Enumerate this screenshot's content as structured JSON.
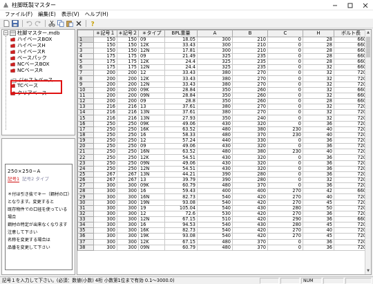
{
  "window": {
    "title": "柱脚既製マスター"
  },
  "menu": [
    "ファイル(F)",
    "編集(E)",
    "表示(V)",
    "ヘルプ(H)"
  ],
  "tree": {
    "root_label": "柱脚マスター.mdb",
    "items": [
      "ハイベースBOX",
      "ハイベースH",
      "ハイベースR",
      "ベースパック",
      "NCベースBOX",
      "NCベースR",
      "ジャストベース",
      "TCベース",
      "クリアベース"
    ],
    "selected_item": "ジャストベース"
  },
  "preview": {
    "size_label": "250×250−A",
    "tag1": "記号1",
    "tag2": "記号2 タイプ",
    "note_lines": [
      "＊付は引き抜でキー（鋼材の口）",
      "となります。変更すると",
      "既存物件での口径を使っている場合",
      "鋼材の特定が出来なくなります",
      "注意して下さい",
      "名称を変更する場合は",
      "品番を変更して下さい"
    ]
  },
  "grid": {
    "columns": [
      "",
      "＊記号１",
      "＊記号２",
      "＊タイプ",
      "BPL重量",
      "A",
      "B",
      "C",
      "H",
      "ボルト長"
    ],
    "rows": [
      [
        "1",
        "150",
        "150",
        "09",
        "18.05",
        "300",
        "210",
        "0",
        "28",
        "660"
      ],
      [
        "2",
        "150",
        "150",
        "12K",
        "33.43",
        "300",
        "210",
        "0",
        "28",
        "660"
      ],
      [
        "3",
        "150",
        "150",
        "12N",
        "17.81",
        "300",
        "210",
        "0",
        "28",
        "660"
      ],
      [
        "4",
        "175",
        "175",
        "09",
        "21.49",
        "325",
        "235",
        "0",
        "28",
        "660"
      ],
      [
        "5",
        "175",
        "175",
        "12K",
        "24.4",
        "325",
        "235",
        "0",
        "28",
        "660"
      ],
      [
        "6",
        "175",
        "175",
        "12N",
        "24.4",
        "325",
        "235",
        "0",
        "32",
        "660"
      ],
      [
        "7",
        "200",
        "200",
        "12",
        "33.43",
        "380",
        "270",
        "0",
        "32",
        "720"
      ],
      [
        "8",
        "200",
        "200",
        "12K",
        "33.43",
        "380",
        "270",
        "0",
        "32",
        "720"
      ],
      [
        "9",
        "200",
        "200",
        "12N",
        "33.43",
        "380",
        "270",
        "0",
        "32",
        "720"
      ],
      [
        "10",
        "200",
        "200",
        "09K",
        "28.84",
        "350",
        "260",
        "0",
        "32",
        "660"
      ],
      [
        "11",
        "200",
        "200",
        "09N",
        "28.84",
        "350",
        "260",
        "0",
        "32",
        "660"
      ],
      [
        "12",
        "200",
        "200",
        "09",
        "28.8",
        "350",
        "260",
        "0",
        "28",
        "660"
      ],
      [
        "13",
        "216",
        "216",
        "13",
        "37.61",
        "380",
        "270",
        "0",
        "32",
        "720"
      ],
      [
        "14",
        "216",
        "216",
        "13N",
        "37.61",
        "380",
        "270",
        "0",
        "32",
        "720"
      ],
      [
        "15",
        "216",
        "216",
        "13N",
        "27.93",
        "350",
        "240",
        "0",
        "32",
        "720"
      ],
      [
        "16",
        "250",
        "250",
        "09K",
        "49.06",
        "430",
        "320",
        "0",
        "36",
        "720"
      ],
      [
        "17",
        "250",
        "250",
        "16K",
        "63.52",
        "480",
        "380",
        "230",
        "40",
        "720"
      ],
      [
        "18",
        "250",
        "250",
        "16",
        "58.33",
        "480",
        "370",
        "230",
        "40",
        "720"
      ],
      [
        "19",
        "250",
        "250",
        "12",
        "57.24",
        "440",
        "330",
        "0",
        "36",
        "720"
      ],
      [
        "20",
        "250",
        "250",
        "09",
        "49.06",
        "430",
        "320",
        "0",
        "36",
        "720"
      ],
      [
        "21",
        "250",
        "250",
        "16N",
        "63.52",
        "480",
        "380",
        "230",
        "40",
        "720"
      ],
      [
        "22",
        "250",
        "250",
        "12K",
        "54.51",
        "430",
        "320",
        "0",
        "36",
        "720"
      ],
      [
        "23",
        "250",
        "250",
        "09N",
        "49.06",
        "430",
        "320",
        "0",
        "36",
        "720"
      ],
      [
        "24",
        "250",
        "250",
        "12N",
        "54.51",
        "430",
        "320",
        "0",
        "36",
        "720"
      ],
      [
        "25",
        "267",
        "267",
        "13N",
        "44.21",
        "390",
        "280",
        "0",
        "36",
        "720"
      ],
      [
        "26",
        "267",
        "267",
        "13",
        "39.79",
        "390",
        "280",
        "0",
        "32",
        "720"
      ],
      [
        "27",
        "300",
        "300",
        "09K",
        "60.79",
        "480",
        "370",
        "0",
        "36",
        "720"
      ],
      [
        "28",
        "300",
        "300",
        "16",
        "59.43",
        "400",
        "400",
        "270",
        "42",
        "660"
      ],
      [
        "29",
        "300",
        "300",
        "16N",
        "82.73",
        "540",
        "420",
        "270",
        "40",
        "720"
      ],
      [
        "30",
        "300",
        "300",
        "19N",
        "93.08",
        "540",
        "420",
        "270",
        "45",
        "720"
      ],
      [
        "31",
        "300",
        "300",
        "19",
        "105.04",
        "540",
        "430",
        "280",
        "50",
        "720"
      ],
      [
        "32",
        "300",
        "300",
        "12",
        "72.6",
        "530",
        "420",
        "270",
        "36",
        "720"
      ],
      [
        "33",
        "300",
        "300",
        "12N",
        "67.15",
        "510",
        "420",
        "290",
        "36",
        "660"
      ],
      [
        "34",
        "300",
        "300",
        "16",
        "94.53",
        "540",
        "430",
        "280",
        "45",
        "720"
      ],
      [
        "35",
        "300",
        "300",
        "16K",
        "82.73",
        "540",
        "420",
        "270",
        "40",
        "720"
      ],
      [
        "36",
        "300",
        "300",
        "19K",
        "93.08",
        "540",
        "420",
        "270",
        "45",
        "720"
      ],
      [
        "37",
        "300",
        "300",
        "12K",
        "67.15",
        "480",
        "370",
        "0",
        "36",
        "720"
      ],
      [
        "38",
        "300",
        "300",
        "09N",
        "60.79",
        "480",
        "370",
        "0",
        "36",
        "720"
      ]
    ]
  },
  "status": {
    "message": "記号１を入力して下さい。(必須：数値(小数) 4桁 小数第1位まで有効 0.1〜3000.0)",
    "indicator": "NUM"
  }
}
